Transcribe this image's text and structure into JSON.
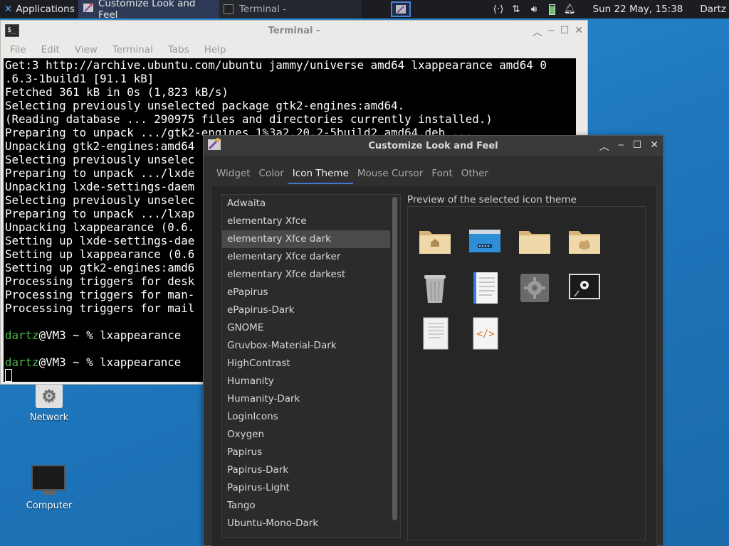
{
  "panel": {
    "apps_label": "Applications",
    "active_task": "Customize Look and Feel",
    "inactive_task": "Terminal -",
    "clock": "Sun 22 May, 15:38",
    "user": "Dartz",
    "tray_icons": [
      "network-arrows-icon",
      "updown-transfer-icon",
      "volume-icon",
      "battery-icon",
      "bell-icon"
    ]
  },
  "desktop": {
    "icons": [
      {
        "label": "Network",
        "icon": "network-gear-icon"
      },
      {
        "label": "Computer",
        "icon": "monitor-icon"
      }
    ]
  },
  "terminal": {
    "title": "Terminal -",
    "menu": [
      "File",
      "Edit",
      "View",
      "Terminal",
      "Tabs",
      "Help"
    ],
    "lines": [
      "Get:3 http://archive.ubuntu.com/ubuntu jammy/universe amd64 lxappearance amd64 0",
      ".6.3-1build1 [91.1 kB]",
      "Fetched 361 kB in 0s (1,823 kB/s)",
      "Selecting previously unselected package gtk2-engines:amd64.",
      "(Reading database ... 290975 files and directories currently installed.)",
      "Preparing to unpack .../gtk2-engines_1%3a2.20.2-5build2_amd64.deb ...",
      "Unpacking gtk2-engines:amd64",
      "Selecting previously unselec",
      "Preparing to unpack .../lxde",
      "Unpacking lxde-settings-daem",
      "Selecting previously unselec",
      "Preparing to unpack .../lxap",
      "Unpacking lxappearance (0.6.",
      "Setting up lxde-settings-dae",
      "Setting up lxappearance (0.6",
      "Setting up gtk2-engines:amd6",
      "Processing triggers for desk",
      "Processing triggers for man-",
      "Processing triggers for mail",
      ""
    ],
    "prompt_user": "dartz",
    "prompt_rest": "@VM3 ~ % ",
    "cmd1": "lxappearance",
    "cmd2": "lxappearance"
  },
  "lxappearance": {
    "title": "Customize Look and Feel",
    "tabs": [
      "Widget",
      "Color",
      "Icon Theme",
      "Mouse Cursor",
      "Font",
      "Other"
    ],
    "selected_tab": "Icon Theme",
    "themes": [
      "Adwaita",
      "elementary Xfce",
      "elementary Xfce dark",
      "elementary Xfce darker",
      "elementary Xfce darkest",
      "ePapirus",
      "ePapirus-Dark",
      "GNOME",
      "Gruvbox-Material-Dark",
      "HighContrast",
      "Humanity",
      "Humanity-Dark",
      "LoginIcons",
      "Oxygen",
      "Papirus",
      "Papirus-Dark",
      "Papirus-Light",
      "Tango",
      "Ubuntu-Mono-Dark"
    ],
    "selected_theme": "elementary Xfce dark",
    "preview_label": "Preview of the selected icon theme",
    "preview_icons": [
      "folder-home-icon",
      "folder-network-icon",
      "folder-icon",
      "folder-cloud-icon",
      "trash-icon",
      "document-icon",
      "settings-gear-icon",
      "settings-panel-icon",
      "text-file-icon",
      "code-file-icon"
    ]
  }
}
